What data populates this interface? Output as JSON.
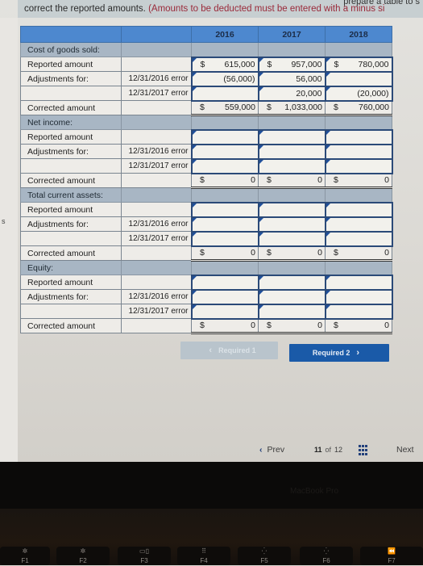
{
  "instructions": {
    "clipped_top_text": "prepare a table to s",
    "text_main": "correct the reported amounts.",
    "text_note": "(Amounts to be deducted must be entered with a minus si"
  },
  "table": {
    "headers": [
      "",
      "",
      "2016",
      "2017",
      "2018"
    ],
    "sections": [
      {
        "title": "Cost of goods sold:",
        "reported_label": "Reported amount",
        "adjust_label": "Adjustments for:",
        "error1_label": "12/31/2016 error",
        "error2_label": "12/31/2017 error",
        "corrected_label": "Corrected amount",
        "reported": [
          {
            "currency": "$",
            "value": "615,000"
          },
          {
            "currency": "$",
            "value": "957,000"
          },
          {
            "currency": "$",
            "value": "780,000"
          }
        ],
        "error1": [
          {
            "currency": "",
            "value": "(56,000)"
          },
          {
            "currency": "",
            "value": "56,000"
          },
          {
            "currency": "",
            "value": ""
          }
        ],
        "error2": [
          {
            "currency": "",
            "value": ""
          },
          {
            "currency": "",
            "value": "20,000"
          },
          {
            "currency": "",
            "value": "(20,000)"
          }
        ],
        "corrected": [
          {
            "currency": "$",
            "value": "559,000"
          },
          {
            "currency": "$",
            "value": "1,033,000"
          },
          {
            "currency": "$",
            "value": "760,000"
          }
        ]
      },
      {
        "title": "Net income:",
        "reported_label": "Reported amount",
        "adjust_label": "Adjustments for:",
        "error1_label": "12/31/2016 error",
        "error2_label": "12/31/2017 error",
        "corrected_label": "Corrected amount",
        "reported": [
          {
            "currency": "",
            "value": ""
          },
          {
            "currency": "",
            "value": ""
          },
          {
            "currency": "",
            "value": ""
          }
        ],
        "error1": [
          {
            "currency": "",
            "value": ""
          },
          {
            "currency": "",
            "value": ""
          },
          {
            "currency": "",
            "value": ""
          }
        ],
        "error2": [
          {
            "currency": "",
            "value": ""
          },
          {
            "currency": "",
            "value": ""
          },
          {
            "currency": "",
            "value": ""
          }
        ],
        "corrected": [
          {
            "currency": "$",
            "value": "0"
          },
          {
            "currency": "$",
            "value": "0"
          },
          {
            "currency": "$",
            "value": "0"
          }
        ]
      },
      {
        "title": "Total current assets:",
        "reported_label": "Reported amount",
        "adjust_label": "Adjustments for:",
        "error1_label": "12/31/2016 error",
        "error2_label": "12/31/2017 error",
        "corrected_label": "Corrected amount",
        "reported": [
          {
            "currency": "",
            "value": ""
          },
          {
            "currency": "",
            "value": ""
          },
          {
            "currency": "",
            "value": ""
          }
        ],
        "error1": [
          {
            "currency": "",
            "value": ""
          },
          {
            "currency": "",
            "value": ""
          },
          {
            "currency": "",
            "value": ""
          }
        ],
        "error2": [
          {
            "currency": "",
            "value": ""
          },
          {
            "currency": "",
            "value": ""
          },
          {
            "currency": "",
            "value": ""
          }
        ],
        "corrected": [
          {
            "currency": "$",
            "value": "0"
          },
          {
            "currency": "$",
            "value": "0"
          },
          {
            "currency": "$",
            "value": "0"
          }
        ]
      },
      {
        "title": "Equity:",
        "reported_label": "Reported amount",
        "adjust_label": "Adjustments for:",
        "error1_label": "12/31/2016 error",
        "error2_label": "12/31/2017 error",
        "corrected_label": "Corrected amount",
        "reported": [
          {
            "currency": "",
            "value": ""
          },
          {
            "currency": "",
            "value": ""
          },
          {
            "currency": "",
            "value": ""
          }
        ],
        "error1": [
          {
            "currency": "",
            "value": ""
          },
          {
            "currency": "",
            "value": ""
          },
          {
            "currency": "",
            "value": ""
          }
        ],
        "error2": [
          {
            "currency": "",
            "value": ""
          },
          {
            "currency": "",
            "value": ""
          },
          {
            "currency": "",
            "value": ""
          }
        ],
        "corrected": [
          {
            "currency": "$",
            "value": "0"
          },
          {
            "currency": "$",
            "value": "0"
          },
          {
            "currency": "$",
            "value": "0"
          }
        ]
      }
    ]
  },
  "nav_buttons": {
    "prev_label": "Required 1",
    "prev_chevron": "‹",
    "next_label": "Required 2",
    "next_chevron": "›"
  },
  "footer": {
    "prev_chevron": "‹",
    "prev_label": "Prev",
    "page_current": "11",
    "page_of": "of",
    "page_total": "12",
    "grid_icon": "grid-icon",
    "next_label": "Next"
  },
  "device": {
    "brand": "MacBook Pro",
    "keys": [
      "F1",
      "F2",
      "F3",
      "F4",
      "F5",
      "F6",
      "F7"
    ]
  },
  "colors": {
    "header_blue": "#4d88cf",
    "section_gray": "#a8b6c4",
    "input_border": "#2b4a78",
    "primary_button": "#1a5aa8",
    "disabled_button": "#b9c4cc",
    "note_red": "#9a2a3a"
  }
}
